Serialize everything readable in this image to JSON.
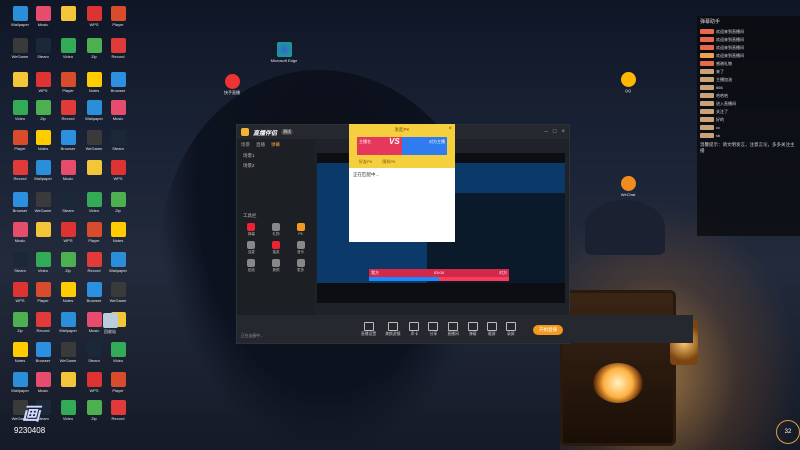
{
  "desktop": {
    "icons_left": [
      {
        "label": "Wallpaper",
        "color": "#2a8fd8"
      },
      {
        "label": "WeGame",
        "color": "#3a3a3a"
      },
      {
        "label": "",
        "color": "#f3c63a"
      },
      {
        "label": "Video",
        "color": "#33aa55"
      },
      {
        "label": "Player",
        "color": "#d94c2b"
      },
      {
        "label": "Record",
        "color": "#e03a3a"
      },
      {
        "label": "Browser",
        "color": "#2d8fe0"
      },
      {
        "label": "Music",
        "color": "#e64c6c"
      },
      {
        "label": "Steam",
        "color": "#1b2838"
      },
      {
        "label": "WPS",
        "color": "#d33"
      },
      {
        "label": "Zip",
        "color": "#4caf50"
      },
      {
        "label": "Notes",
        "color": "#ffcc00"
      }
    ],
    "shortcut_labels": {
      "microsoft_edge": "Microsoft Edge",
      "kuaishou": "快手直播",
      "qq": "QQ",
      "wechat": "WeChat",
      "recycle": "回收站"
    }
  },
  "chat": {
    "title": "弹幕助手",
    "messages": [
      "欢迎来到直播间",
      "欢迎来到直播间",
      "欢迎来到直播间",
      "欢迎来到直播间",
      "感谢礼物",
      "来了",
      "主播加油",
      "666",
      "哈哈哈",
      "进入直播间",
      "关注了",
      "好的",
      "cc",
      "sb"
    ],
    "note": "温馨提示：请文明发言，注意言论，多多关注主播"
  },
  "app": {
    "brand": "直播伴侣",
    "version": "测试",
    "tabs": [
      "场景",
      "直播",
      "弹幕"
    ],
    "active_tab": "弹幕",
    "scene_items": [
      "场景1",
      "场景2"
    ],
    "tools_title": "工具栏",
    "tools": [
      "弹幕",
      "礼物",
      "PK",
      "连麦",
      "抽奖",
      "音乐",
      "贴纸",
      "美颜",
      "更多"
    ],
    "bottom_buttons": [
      "直播设置",
      "美颜滤镜",
      "声卡",
      "分享",
      "直播间",
      "弹幕",
      "截屏",
      "录屏"
    ],
    "go_live": "开始直播",
    "status": "正在连接中...",
    "pk": {
      "left": "我方",
      "right": "对方",
      "time": "03:00",
      "label": "VS"
    }
  },
  "dialog": {
    "title": "发起PK",
    "vs": "VS",
    "left_name": "主播名",
    "right_name": "对方主播",
    "opt1": "好友PK",
    "opt2": "随机PK",
    "body": "正在匹配中..."
  },
  "badge": {
    "big": "画",
    "number": "9230408"
  },
  "clock": "32"
}
